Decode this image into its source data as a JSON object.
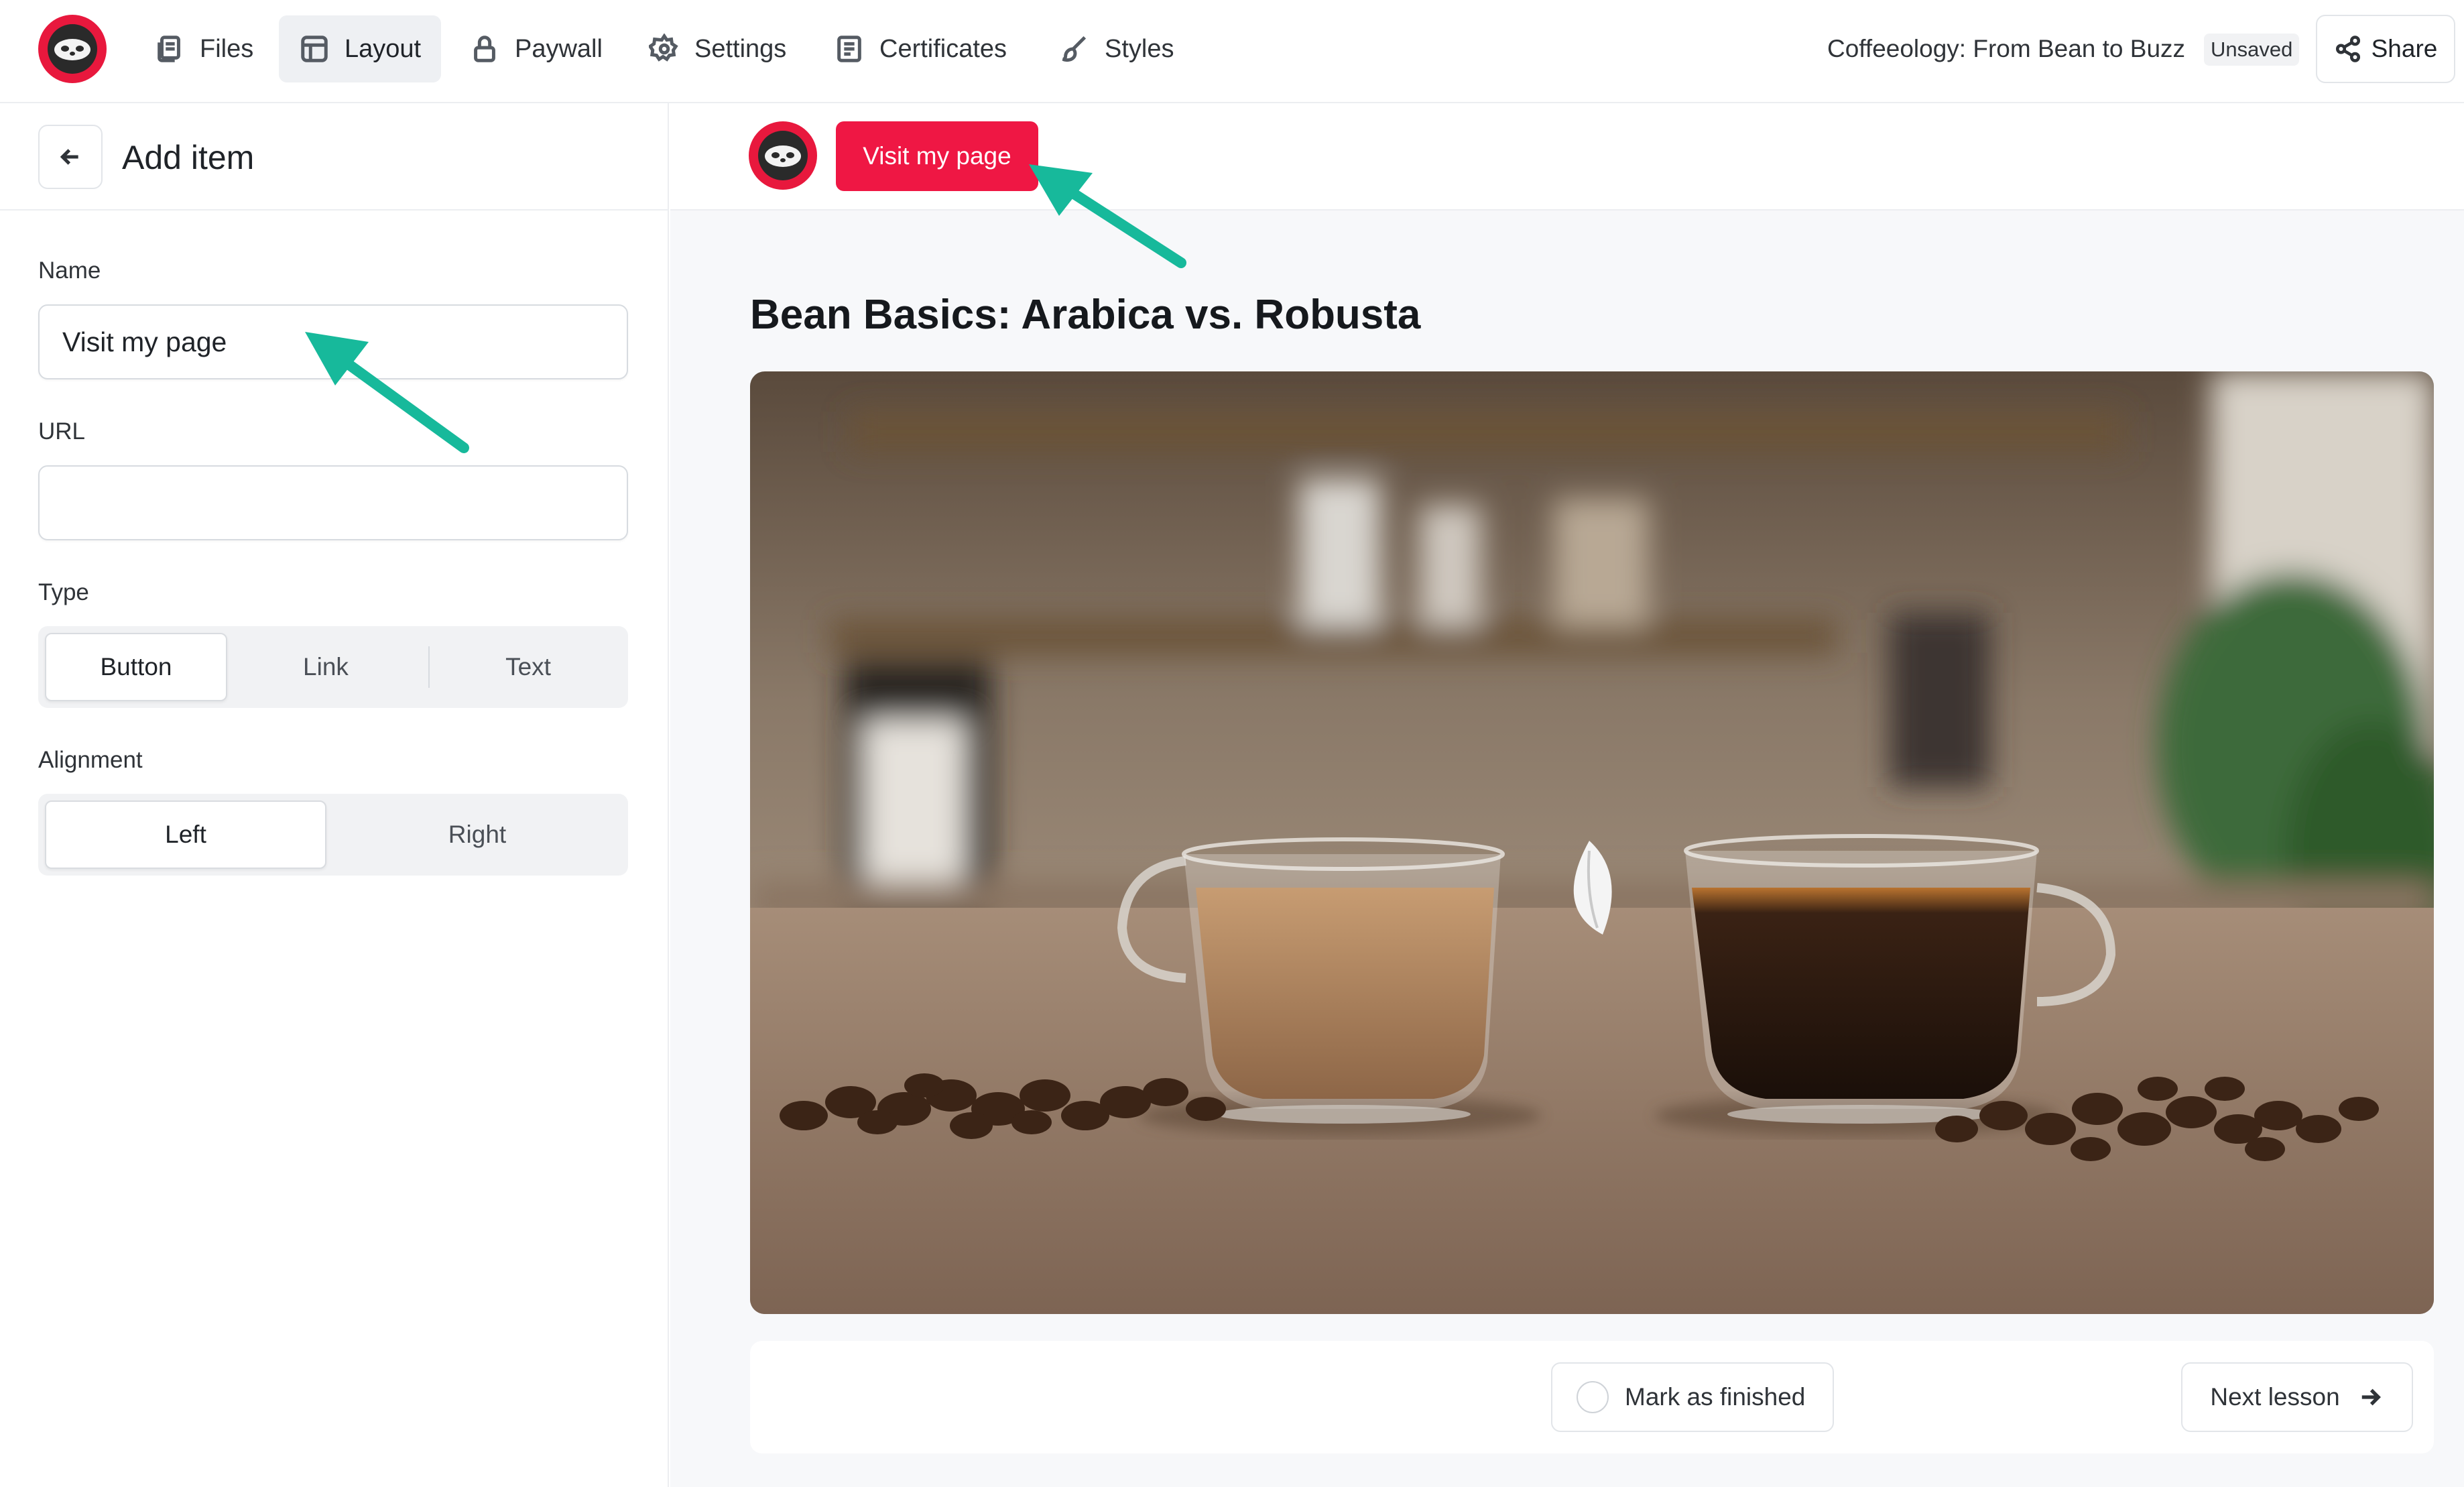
{
  "nav": {
    "items": [
      {
        "label": "Files",
        "icon": "files-icon"
      },
      {
        "label": "Layout",
        "icon": "layout-icon",
        "active": true
      },
      {
        "label": "Paywall",
        "icon": "lock-icon"
      },
      {
        "label": "Settings",
        "icon": "gear-icon"
      },
      {
        "label": "Certificates",
        "icon": "certificate-icon"
      },
      {
        "label": "Styles",
        "icon": "brush-icon"
      }
    ],
    "document_title": "Coffeeology: From Bean to Buzz",
    "status_badge": "Unsaved",
    "share_label": "Share"
  },
  "panel": {
    "title": "Add item",
    "name_label": "Name",
    "name_value": "Visit my page",
    "url_label": "URL",
    "url_value": "",
    "type_label": "Type",
    "type_options": [
      "Button",
      "Link",
      "Text"
    ],
    "type_selected": "Button",
    "alignment_label": "Alignment",
    "alignment_options": [
      "Left",
      "Right"
    ],
    "alignment_selected": "Left"
  },
  "preview": {
    "visit_button_label": "Visit my page",
    "lesson_title": "Bean Basics: Arabica vs. Robusta",
    "mark_finished_label": "Mark as finished",
    "next_lesson_label": "Next lesson"
  },
  "colors": {
    "brand_red": "#ef1744",
    "annotation_arrow": "#17b99b"
  }
}
